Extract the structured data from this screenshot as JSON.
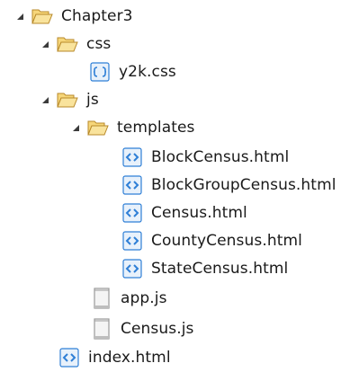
{
  "colors": {
    "expander": "#3b3b3b",
    "folder_fill": "#f6d67a",
    "folder_stroke": "#b8892a",
    "web_file_blue": "#2f7fd6",
    "js_file_gray": "#9a9a9a"
  },
  "tree": {
    "root": {
      "label": "Chapter3",
      "icon": "folder-open-icon",
      "expanded": true
    },
    "css_folder": {
      "label": "css",
      "icon": "folder-open-icon",
      "expanded": true
    },
    "css_file": {
      "label": "y2k.css",
      "icon": "css-file-icon"
    },
    "js_folder": {
      "label": "js",
      "icon": "folder-open-icon",
      "expanded": true
    },
    "templates_folder": {
      "label": "templates",
      "icon": "folder-open-icon",
      "expanded": true
    },
    "templates_files": [
      {
        "label": "BlockCensus.html",
        "icon": "html-file-icon"
      },
      {
        "label": "BlockGroupCensus.html",
        "icon": "html-file-icon"
      },
      {
        "label": "Census.html",
        "icon": "html-file-icon"
      },
      {
        "label": "CountyCensus.html",
        "icon": "html-file-icon"
      },
      {
        "label": "StateCensus.html",
        "icon": "html-file-icon"
      }
    ],
    "js_files": [
      {
        "label": "app.js",
        "icon": "js-file-icon"
      },
      {
        "label": "Census.js",
        "icon": "js-file-icon"
      }
    ],
    "index_file": {
      "label": "index.html",
      "icon": "html-file-icon"
    }
  }
}
